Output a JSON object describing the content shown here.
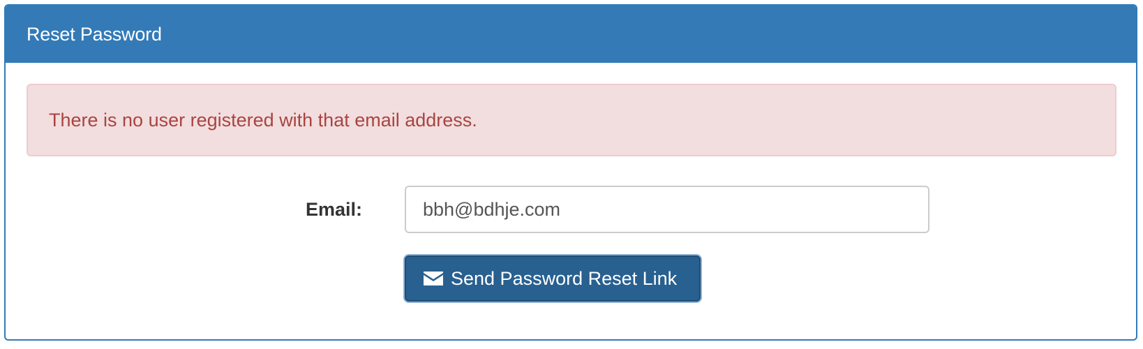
{
  "panel": {
    "title": "Reset Password"
  },
  "alert": {
    "message": "There is no user registered with that email address."
  },
  "form": {
    "email_label": "Email:",
    "email_value": "bbh@bdhje.com",
    "submit_label": "Send Password Reset Link",
    "submit_icon": "envelope-icon"
  },
  "colors": {
    "primary": "#337ab7",
    "button": "#286090",
    "alert_bg": "#f2dede",
    "alert_text": "#a94442"
  }
}
